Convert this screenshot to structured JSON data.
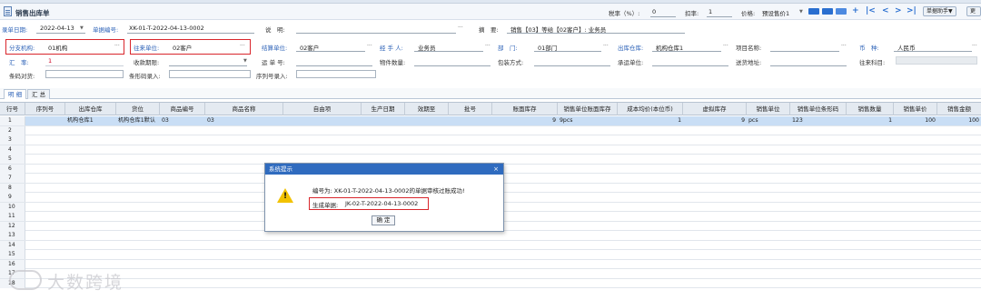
{
  "page": {
    "title": "销售出库单"
  },
  "toolbar": {
    "tax_label": "税率（%）:",
    "tax_value": "0",
    "discount_label": "扣率:",
    "discount_value": "1",
    "price_label": "价格:",
    "price_value": "预设售价1",
    "help_label": "单据助手▼",
    "more_label": "更多"
  },
  "header": {
    "date_label": "录单日期:",
    "date_value": "2022-04-13",
    "docno_label": "单据编号:",
    "docno_value": "XK-01-T-2022-04-13-0002",
    "desc_label": "说　明:",
    "desc_value": "",
    "summary_label": "摘　要:",
    "summary_value": "销售【03】等给【02客户】: 业务员"
  },
  "form": {
    "branch_label": "分支机构:",
    "branch_value": "01机构",
    "partner_label": "往来单位:",
    "partner_value": "02客户",
    "settle_label": "结算单位:",
    "settle_value": "02客户",
    "handler_label": "经 手 人:",
    "handler_value": "业务员",
    "dept_label": "部　门:",
    "dept_value": "01部门",
    "warehouse_label": "出库仓库:",
    "warehouse_value": "机构仓库1",
    "project_label": "项目名称:",
    "project_value": "",
    "currency_label": "币　种:",
    "currency_value": "人民币",
    "rate_label": "汇　率:",
    "rate_value": "1",
    "period_label": "收款期限:",
    "period_value": "",
    "shipno_label": "运 单 号:",
    "shipno_value": "",
    "pieces_label": "物件数量:",
    "pieces_value": "",
    "pack_label": "包装方式:",
    "pack_value": "",
    "carrier_label": "承运单位:",
    "carrier_value": "",
    "address_label": "送货地址:",
    "address_value": "",
    "account_label": "往来科目:",
    "account_value": "",
    "barcode_scan_label": "条码对货:",
    "barcode_entry_label": "条形码录入:",
    "serial_entry_label": "序列号录入:"
  },
  "tabs": [
    {
      "label": "明 细"
    },
    {
      "label": "汇 总"
    }
  ],
  "grid": {
    "columns": [
      "行号",
      "序列号",
      "出库仓库",
      "货位",
      "商品编号",
      "商品名称",
      "自由项",
      "生产日期",
      "效期至",
      "批号",
      "账面库存",
      "销售单位账面库存",
      "成本均价(本位币)",
      "虚拟库存",
      "销售单位",
      "销售单位条形码",
      "销售数量",
      "销售单价",
      "销售金额"
    ],
    "rows": [
      {
        "no": "1",
        "serial": "",
        "warehouse": "机构仓库1",
        "location": "机构仓库1默认",
        "code": "03",
        "name": "03",
        "free": "",
        "prod": "",
        "expire": "",
        "batch": "",
        "stock": "9",
        "unit_stock": "9pcs",
        "cost": "1",
        "virtual": "9",
        "unit": "pcs",
        "unit_barcode": "123",
        "qty": "1",
        "price": "100",
        "amount": "100"
      },
      {
        "no": "2"
      },
      {
        "no": "3"
      },
      {
        "no": "4"
      },
      {
        "no": "5"
      },
      {
        "no": "6"
      },
      {
        "no": "7"
      },
      {
        "no": "8"
      },
      {
        "no": "9"
      },
      {
        "no": "10"
      },
      {
        "no": "11"
      },
      {
        "no": "12"
      },
      {
        "no": "13"
      },
      {
        "no": "14"
      },
      {
        "no": "15"
      },
      {
        "no": "16"
      },
      {
        "no": "17"
      },
      {
        "no": "18"
      }
    ]
  },
  "dialog": {
    "title": "系统提示",
    "message": "编号为: XK-01-T-2022-04-13-0002的单据审核过账成功!",
    "generated_label": "生成单据:",
    "generated_value": "JK-02-T-2022-04-13-0002",
    "ok_label": "确 定"
  },
  "watermark": {
    "text": "大数跨境"
  }
}
